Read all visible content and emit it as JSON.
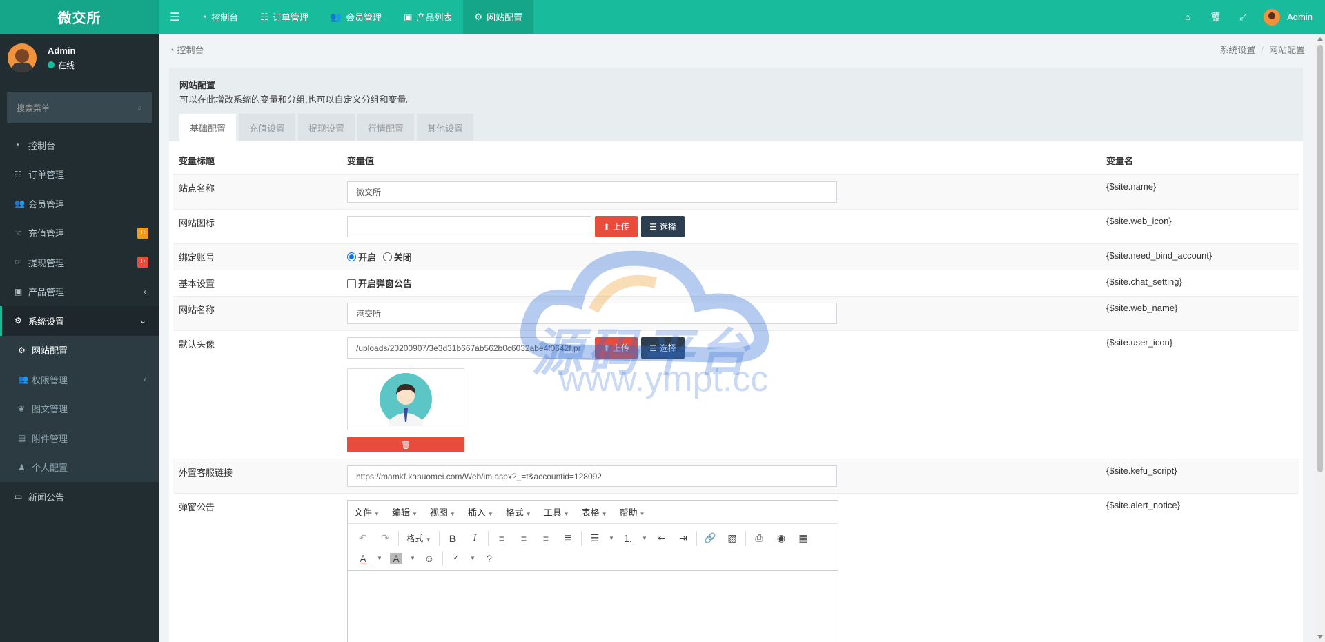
{
  "header": {
    "logo": "微交所",
    "nav": [
      {
        "label": "控制台",
        "icon": "dashboard-icon"
      },
      {
        "label": "订单管理",
        "icon": "list-icon"
      },
      {
        "label": "会员管理",
        "icon": "users-icon"
      },
      {
        "label": "产品列表",
        "icon": "shopping-bag-icon"
      },
      {
        "label": "网站配置",
        "icon": "gear-icon"
      }
    ],
    "user": "Admin"
  },
  "sidebar": {
    "user": {
      "name": "Admin",
      "status": "在线"
    },
    "search_placeholder": "搜索菜单",
    "items": [
      {
        "label": "控制台"
      },
      {
        "label": "订单管理"
      },
      {
        "label": "会员管理"
      },
      {
        "label": "充值管理",
        "badge": "0"
      },
      {
        "label": "提现管理",
        "badge": "0"
      },
      {
        "label": "产品管理"
      },
      {
        "label": "系统设置"
      }
    ],
    "sub_items": [
      {
        "label": "网站配置"
      },
      {
        "label": "权限管理"
      },
      {
        "label": "图文管理"
      },
      {
        "label": "附件管理"
      },
      {
        "label": "个人配置"
      }
    ],
    "last_item": {
      "label": "新闻公告"
    }
  },
  "breadcrumb": {
    "left": "控制台",
    "right": [
      "系统设置",
      "网站配置"
    ]
  },
  "panel": {
    "title": "网站配置",
    "description": "可以在此增改系统的变量和分组,也可以自定义分组和变量。",
    "tabs": [
      "基础配置",
      "充值设置",
      "提现设置",
      "行情配置",
      "其他设置"
    ]
  },
  "table": {
    "headers": [
      "变量标题",
      "变量值",
      "变量名"
    ],
    "rows": {
      "site_name": {
        "title": "站点名称",
        "value": "微交所",
        "var": "{$site.name}"
      },
      "web_icon": {
        "title": "网站图标",
        "value": "",
        "var": "{$site.web_icon}"
      },
      "bind_account": {
        "title": "绑定账号",
        "opt_on": "开启",
        "opt_off": "关闭",
        "var": "{$site.need_bind_account}"
      },
      "chat_setting": {
        "title": "基本设置",
        "checkbox": "开启弹窗公告",
        "var": "{$site.chat_setting}"
      },
      "web_name": {
        "title": "网站名称",
        "value": "港交所",
        "var": "{$site.web_name}"
      },
      "user_icon": {
        "title": "默认头像",
        "value": "/uploads/20200907/3e3d31b667ab562b0c6032abe4f0642f.pr",
        "var": "{$site.user_icon}"
      },
      "kefu": {
        "title": "外置客服链接",
        "value": "https://mamkf.kanuomei.com/Web/im.aspx?_=t&accountid=128092",
        "var": "{$site.kefu_script}"
      },
      "alert_notice": {
        "title": "弹窗公告",
        "var": "{$site.alert_notice}"
      }
    },
    "upload_label": "上传",
    "select_label": "选择"
  },
  "editor": {
    "menus": [
      "文件",
      "编辑",
      "视图",
      "插入",
      "格式",
      "工具",
      "表格",
      "帮助"
    ],
    "format_label": "格式"
  },
  "watermark": {
    "text": "源码平台",
    "url": "www.ympt.cc"
  }
}
